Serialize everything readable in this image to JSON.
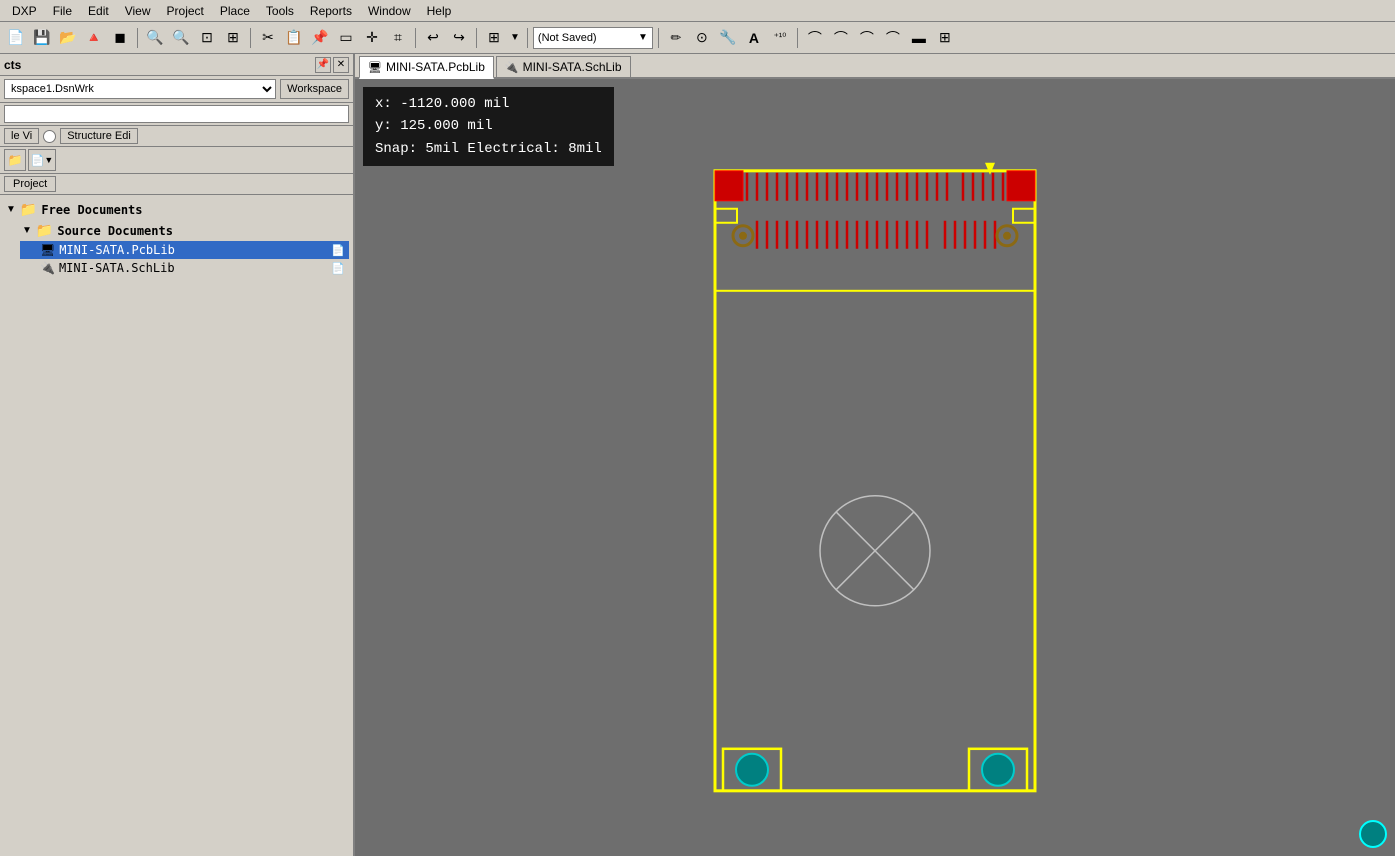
{
  "app": {
    "title": "DXP"
  },
  "menubar": {
    "items": [
      "DXP",
      "File",
      "Edit",
      "View",
      "Project",
      "Place",
      "Tools",
      "Reports",
      "Window",
      "Help"
    ]
  },
  "toolbar": {
    "not_saved_label": "(Not Saved)"
  },
  "panel": {
    "title": "cts",
    "workspace_value": "kspace1.DsnWrk",
    "workspace_btn": "Workspace",
    "project_btn": "Project",
    "tab1": "le Vi",
    "tab2": "Structure Edi",
    "free_docs_label": "Free Documents",
    "source_docs_label": "Source Documents",
    "items": [
      {
        "name": "MINI-SATA.PcbLib",
        "type": "pcb",
        "selected": true
      },
      {
        "name": "MINI-SATA.SchLib",
        "type": "sch",
        "selected": false
      }
    ]
  },
  "tabs": [
    {
      "label": "MINI-SATA.PcbLib",
      "active": true
    },
    {
      "label": "MINI-SATA.SchLib",
      "active": false
    }
  ],
  "coordinates": {
    "x_label": "x: -1120.000 mil",
    "y_label": "y:   125.000 mil",
    "snap_label": "Snap: 5mil Electrical: 8mil"
  }
}
